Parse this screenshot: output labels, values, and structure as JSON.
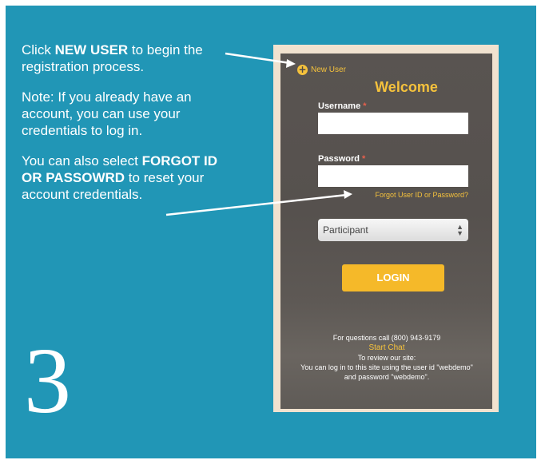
{
  "instructions": {
    "p1_pre": "Click ",
    "p1_bold": "NEW USER",
    "p1_post": " to begin the registration process.",
    "p2": "Note: If you already have an account, you can use your credentials to log in.",
    "p3_pre": "You can also select ",
    "p3_bold": "FORGOT ID OR PASSOWRD",
    "p3_post": " to reset your account credentials."
  },
  "step_number": "3",
  "login_screen": {
    "new_user_icon": "plus-circle-icon",
    "new_user_label": "New User",
    "welcome": "Welcome",
    "username_label": "Username",
    "password_label": "Password",
    "required_marker": "*",
    "username_value": "",
    "password_value": "",
    "forgot_link": "Forgot User ID or Password?",
    "role_select": "Participant",
    "login_button": "LOGIN",
    "questions": "For questions call (800) 943-9179",
    "start_chat": "Start Chat",
    "review_line1": "To review our site:",
    "review_line2": "You can log in to this site using the user id \"webdemo\"",
    "review_line3": "and password \"webdemo\"."
  },
  "colors": {
    "background": "#2196b6",
    "accent": "#f5c23c",
    "screen": "#57524f"
  }
}
